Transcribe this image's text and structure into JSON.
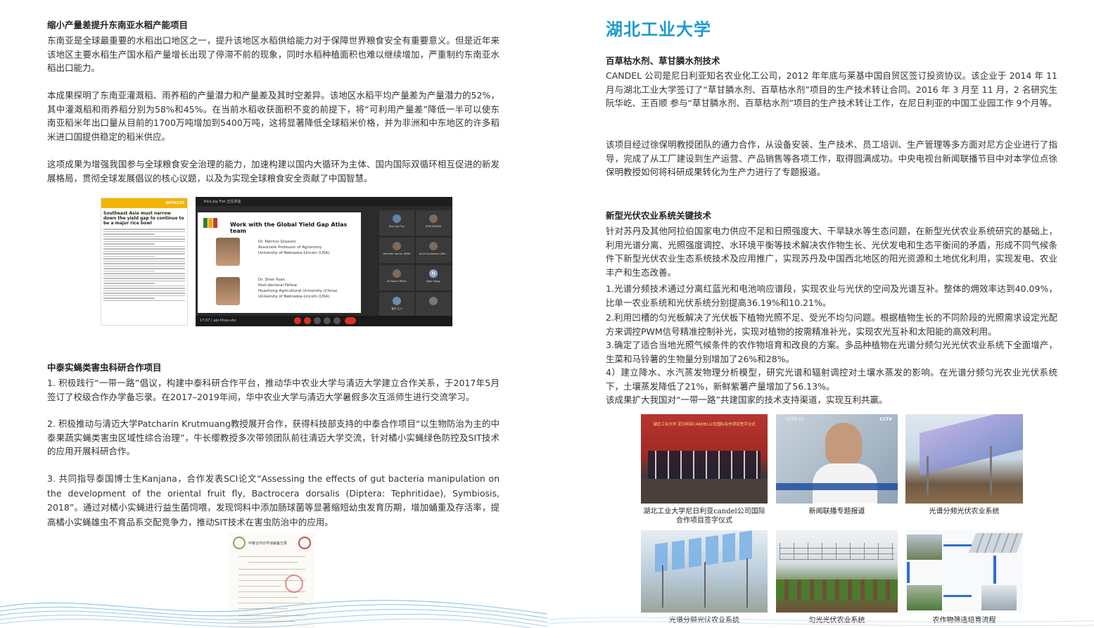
{
  "left": {
    "s1": {
      "title": "缩小产量差提升东南亚水稻产能项目",
      "paragraphs": [
        "东南亚是全球最重要的水稻出口地区之一，提升该地区水稻供给能力对于保障世界粮食安全有重要意义。但是近年来该地区主要水稻生产国水稻产量增长出现了停滞不前的现象，同时水稻种植面积也难以继续增加，严重制约东南亚水稻出口能力。",
        "本成果探明了东南亚灌溉稻、雨养稻的产量潜力和产量差及其时空差异。该地区水稻平均产量差为产量潜力的52%，其中灌溉稻和雨养稻分别为58%和45%。在当前水稻收获面积不变的前提下，将“可利用产量差”降低一半可以使东南亚稻米年出口量从目前的1700万吨增加到5400万吨，这将显著降低全球稻米价格，并为非洲和中东地区的许多稻米进口国提供稳定的稻米供应。",
        "这项成果为增强我国参与全球粮食安全治理的能力，加速构建以国内大循环为主体、国内国际双循环相互促进的新发展格局，贯彻全球发展倡议的核心议题，以及为实现全球粮食安全贡献了中国智慧。"
      ]
    },
    "article": {
      "badge": "ARTICLES",
      "title": "Southeast Asia must narrow down the yield gap to continue to be a major rice bowl"
    },
    "zoom": {
      "window_title": "Rica Joy Flor 正在讲话",
      "slide_title": "Work with the Global Yield Gap Atlas team",
      "person1": [
        "Dr. Patricio Grassini",
        "Associate Professor of Agronomy",
        "University of Nebraska-Lincoln (USA)"
      ],
      "person2": [
        "Dr. Shen Yuan",
        "Post-doctoral Fellow",
        "Huazhong Agricultural University (China)",
        "University of Nebraska-Lincoln (USA)"
      ],
      "tiles": [
        "Rica Joy Flor",
        "SOM BUNNA",
        "Virender Kumar (IRRI)",
        "Amit Srivastava (IRR...",
        "Mu'tazim Billah",
        "Ngon Ngoy",
        "曾亦 主人",
        ""
      ],
      "tile_initial": "N",
      "time": "17:07 | api-hhvp-vkx"
    },
    "s2": {
      "title": "中泰实蝇类害虫科研合作项目",
      "paragraphs": [
        "1. 积极践行“一带一路”倡议，构建中泰科研合作平台，推动华中农业大学与清迈大学建立合作关系，于2017年5月签订了校级合作办学备忘录。在2017–2019年间，华中农业大学与清迈大学暑假多次互派师生进行交流学习。",
        "2. 积极推动与清迈大学Patcharin Krutmuang教授展开合作，获得科技部支持的中泰合作项目“以生物防治为主的中泰果蔬实蝇类害虫区域性综合治理”，牛长缨教授多次带领团队前往清迈大学交流，针对橘小实蝇绿色防控及SIT技术的应用开展科研合作。",
        "3. 共同指导泰国博士生Kanjana，合作发表SCI论文“Assessing the effects of gut bacteria manipulation on the development of the oriental fruit fly, Bactrocera dorsalis (Diptera: Tephritidae), Symbiosis, 2018”。通过对橘小实蝇进行益生菌饲喂，发现饲料中添加肠球菌等显著缩短幼虫发育历期，增加蛹重及存活率，提高橘小实蝇雄虫不育品系交配竞争力，推动SIT技术在害虫防治中的应用。"
      ]
    },
    "cert": {
      "heading": "中泰合作办学谅解备忘录"
    }
  },
  "right": {
    "university": "湖北工业大学",
    "s1": {
      "title": "百草枯水剂、草甘膦水剂技术",
      "paragraphs": [
        "CANDEL 公司是尼日利亚知名农业化工公司，2012 年年底与莱基中国自贸区签订投资协议。该企业于 2014 年 11 月与湖北工业大学签订了“草甘膦水剂、百草枯水剂”项目的生产技术转让合同。2016 年 3 月至 11 月，2 名研究生阮华屹、王百顺 参与“草甘膦水剂、百草枯水剂”项目的生产技术转让工作，在尼日利亚的中国工业园工作 9个月等。",
        "该项目经过徐保明教授团队的通力合作，从设备安装、生产技术、员工培训、生产管理等多方面对尼方企业进行了指导，完成了从工厂建设到生产运营、产品销售等各项工作，取得圆满成功。中央电视台新闻联播节目中对本学位点徐保明教授如何将科研成果转化为生产力进行了专题报道。"
      ]
    },
    "s2": {
      "title": "新型光伏农业系统关键技术",
      "paragraphs": [
        "针对苏丹及其他阿拉伯国家电力供应不足和日照强度大、干旱缺水等生态问题，在新型光伏农业系统研究的基础上，利用光谱分离、光照强度调控、水环境平衡等技术解决农作物生长、光伏发电和生态平衡间的矛盾，形成不同气候条件下新型光伏农业生态系统技术及应用推广，实现苏丹及中国西北地区的阳光资源和土地优化利用，实现发电、农业丰产和生态改善。",
        "1.光谱分频技术通过分离红蓝光和电池响应谱段，实现农业与光伏的空间及光谱互补。整体的㶲效率达到40.09%，比单一农业系统和光伏系统分别提高36.19%和10.21%。",
        "2.利用凹槽的匀光板解决了光伏板下植物光照不足、受光不均匀问题。根据植物生长的不同阶段的光照需求设定光配方来调控PWM信号精准控制补光，实现对植物的按需精准补光，实现农光互补和太阳能的高效利用。",
        "3.确定了适合当地光照气候条件的农作物培育和改良的方案。多品种植物在光谱分频匀光光伏农业系统下全面增产，生菜和马铃薯的生物量分别增加了26%和28%。",
        "4）建立降水、水汽蒸发物理分析模型，研究光谱和辐射调控对土壤水蒸发的影响。在光谱分频匀光农业光伏系统下，土壤蒸发降低了21%，新鲜紫薯产量增加了56.13%。",
        "该成果扩大我国对“一带一路”共建国家的技术支持渠道，实现互利共赢。"
      ]
    },
    "photos": {
      "p1_caption": "湖北工业大学尼日利亚candel公司国际合作项目签字仪式",
      "p1_banner": "湖北工业大学 尼日利亚CANDEL公司国际合作项目签字仪式",
      "p2_caption": "新闻联播专题报道",
      "p2_logo1": "CCTV-13",
      "p2_logo2": "CCTV",
      "p3_caption": "光谱分频光伏农业系统",
      "p4_caption": "光谱分频光伏农业系统",
      "p5_caption": "匀光光伏农业系统",
      "p6_caption": "农作物筛选培育流程"
    }
  },
  "colors": {
    "accent": "#1d9bd1",
    "wave": "#2a8fd0"
  }
}
